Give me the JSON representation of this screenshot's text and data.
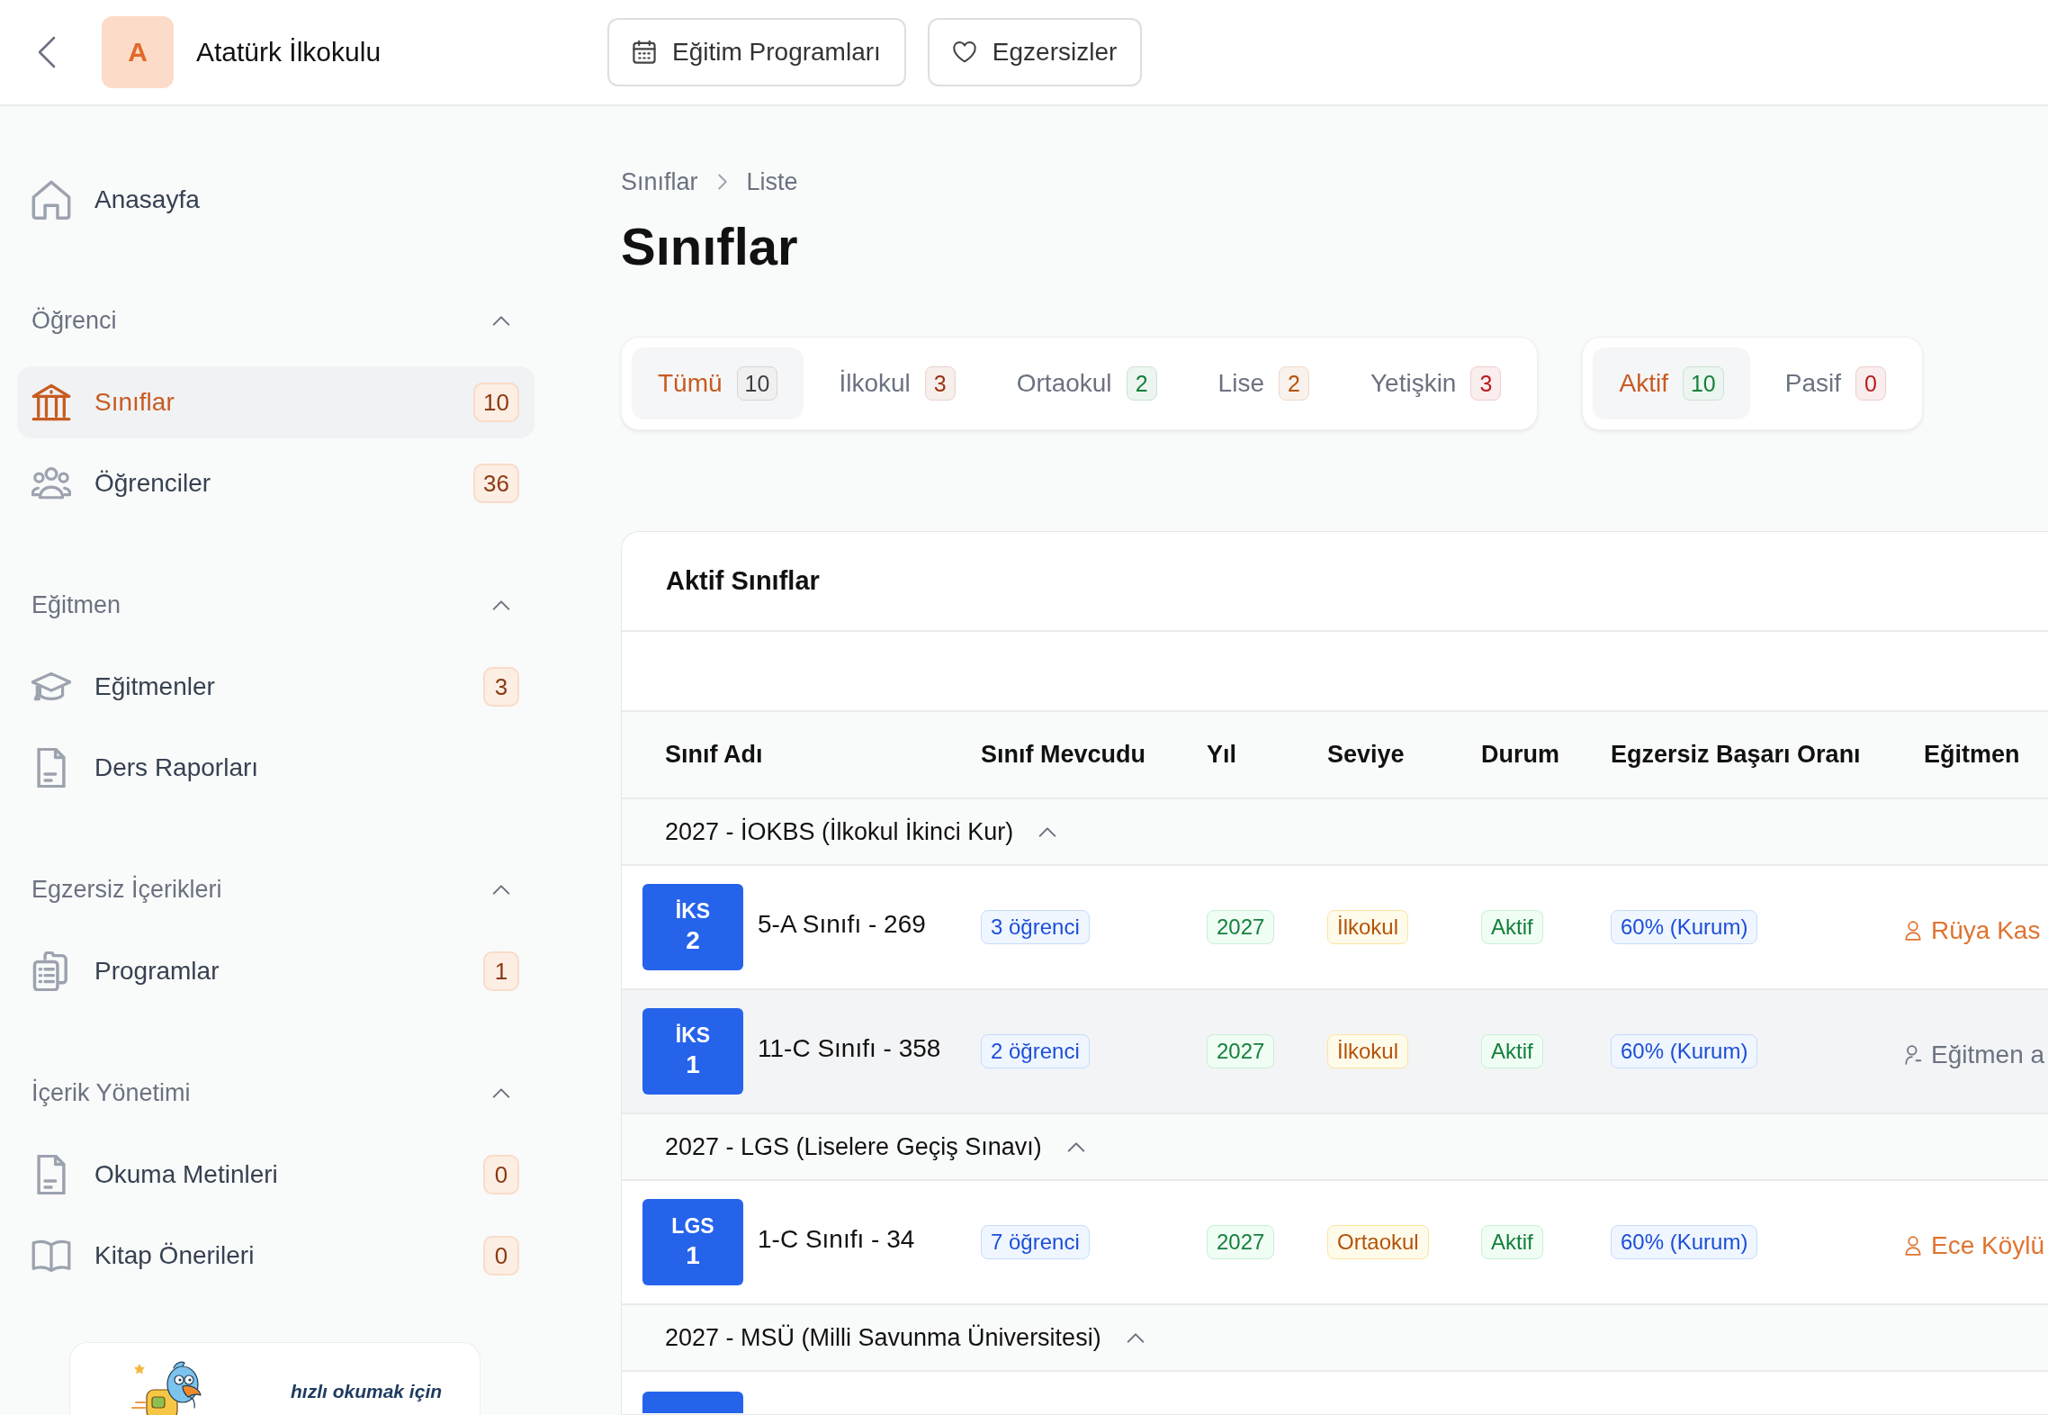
{
  "top_bar": {
    "school": {
      "initial": "A",
      "name": "Atatürk İlkokulu"
    },
    "buttons": [
      "Eğitim Programları",
      "Egzersizler"
    ]
  },
  "sidebar": {
    "home": {
      "label": "Anasayfa",
      "selected": false
    },
    "sections": [
      {
        "title": "Öğrenci",
        "expanded": true,
        "items": [
          {
            "label": "Sınıflar",
            "count": "10",
            "selected": true
          },
          {
            "label": "Öğrenciler",
            "count": "36",
            "selected": false
          }
        ]
      },
      {
        "title": "Eğitmen",
        "expanded": true,
        "items": [
          {
            "label": "Eğitmenler",
            "count": "3",
            "selected": false
          },
          {
            "label": "Ders Raporları",
            "selected": false
          }
        ]
      },
      {
        "title": "Egzersiz İçerikleri",
        "expanded": true,
        "items": [
          {
            "label": "Programlar",
            "count": "1",
            "selected": false
          }
        ]
      },
      {
        "title": "İçerik Yönetimi",
        "expanded": true,
        "items": [
          {
            "label": "Okuma Metinleri",
            "count": "0",
            "selected": false
          },
          {
            "label": "Kitap Önerileri",
            "count": "0",
            "selected": false
          }
        ]
      }
    ],
    "promo": {
      "tagline": "hızlı okumak için"
    }
  },
  "breadcrumb": [
    "Sınıflar",
    "Liste"
  ],
  "page_title": "Sınıflar",
  "level_filters": [
    {
      "label": "Tümü",
      "count": "10",
      "color": "#3f3f46",
      "selected": true
    },
    {
      "label": "İlkokul",
      "count": "3",
      "color": "#9a3412",
      "selected": false
    },
    {
      "label": "Ortaokul",
      "count": "2",
      "color": "#15803d",
      "selected": false
    },
    {
      "label": "Lise",
      "count": "2",
      "color": "#b45309",
      "selected": false
    },
    {
      "label": "Yetişkin",
      "count": "3",
      "color": "#b91c1c",
      "selected": false
    }
  ],
  "status_filters": [
    {
      "label": "Aktif",
      "count": "10",
      "color": "#15803d",
      "selected": true
    },
    {
      "label": "Pasif",
      "count": "0",
      "color": "#b91c1c",
      "selected": false
    }
  ],
  "table": {
    "title": "Aktif Sınıflar",
    "columns": [
      "Sınıf Adı",
      "Sınıf Mevcudu",
      "Yıl",
      "Seviye",
      "Durum",
      "Egzersiz Başarı Oranı",
      "Eğitmen"
    ],
    "groups": [
      {
        "title": "2027 - İOKBS (İlkokul İkinci Kur)",
        "expanded": true,
        "rows": [
          {
            "kind": "class",
            "code": "İKS",
            "number": "2",
            "name": "5-A Sınıfı - 269",
            "students": "3 öğrenci",
            "year": "2027",
            "school_level": "İlkokul",
            "status": "Aktif",
            "success_rate": "60% (Kurum)",
            "teacher": {
              "name": "Rüya Kas",
              "assigned": true
            },
            "highlighted": false
          },
          {
            "kind": "class",
            "code": "İKS",
            "number": "1",
            "name": "11-C Sınıfı - 358",
            "students": "2 öğrenci",
            "year": "2027",
            "school_level": "İlkokul",
            "status": "Aktif",
            "success_rate": "60% (Kurum)",
            "teacher": {
              "name": "Eğitmen a",
              "assigned": false
            },
            "highlighted": true
          }
        ]
      },
      {
        "title": "2027 - LGS (Liselere Geçiş Sınavı)",
        "expanded": true,
        "rows": [
          {
            "kind": "class",
            "code": "LGS",
            "number": "1",
            "name": "1-C Sınıfı - 34",
            "students": "7 öğrenci",
            "year": "2027",
            "school_level": "Ortaokul",
            "status": "Aktif",
            "success_rate": "60% (Kurum)",
            "teacher": {
              "name": "Ece Köylü",
              "assigned": true
            },
            "highlighted": false
          }
        ]
      },
      {
        "title": "2027 - MSÜ (Milli Savunma Üniversitesi)",
        "expanded": true,
        "rows": [
          {
            "kind": "cut"
          }
        ]
      }
    ]
  }
}
